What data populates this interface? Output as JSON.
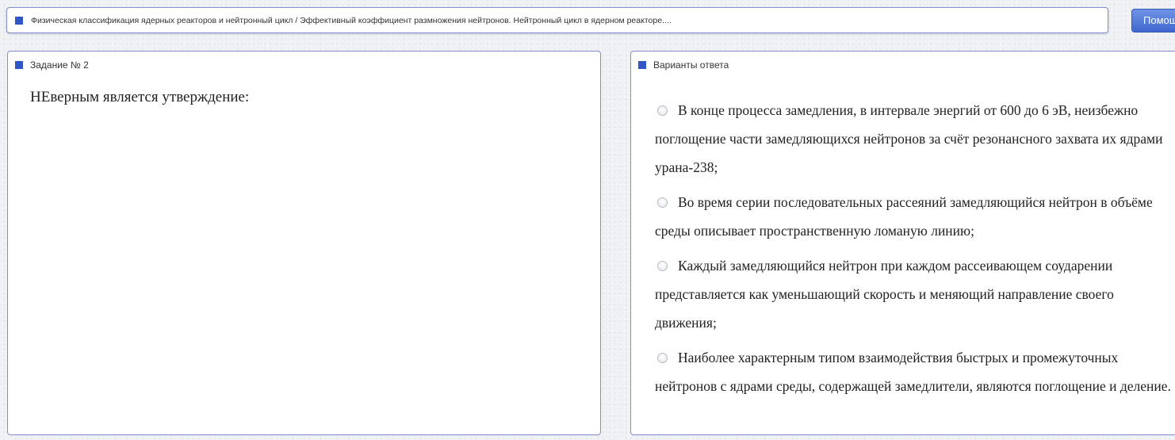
{
  "topic": {
    "text": "Физическая классификация ядерных реакторов и нейтронный цикл / Эффективный коэффициент размножения нейтронов. Нейтронный цикл в ядерном реакторе...."
  },
  "help_button": {
    "label": "Помощь"
  },
  "task": {
    "title": "Задание № 2",
    "question": "НЕверным является утверждение:"
  },
  "answers": {
    "title": "Варианты ответа",
    "options": [
      {
        "label": "В конце процесса замедления, в интервале энергий от 600 до 6 эВ, неизбежно поглощение части замедляющихся нейтронов за счёт резонансного захвата их ядрами урана-238;",
        "selected": false
      },
      {
        "label": "Во время серии последовательных рассеяний замедляющийся нейтрон в объёме среды описывает пространственную ломаную линию;",
        "selected": false
      },
      {
        "label": "Каждый замедляющийся нейтрон при каждом рассеивающем соударении представляется как уменьшающий скорость и меняющий направление своего движения;",
        "selected": false
      },
      {
        "label": "Наиболее характерным типом взаимодействия быстрых и промежуточных нейтронов с ядрами среды, содержащей замедлители, являются поглощение и деление.",
        "selected": false
      }
    ]
  },
  "colors": {
    "accent": "#2f55c7",
    "border": "#7f8fc9",
    "button": "#4f78dc"
  }
}
